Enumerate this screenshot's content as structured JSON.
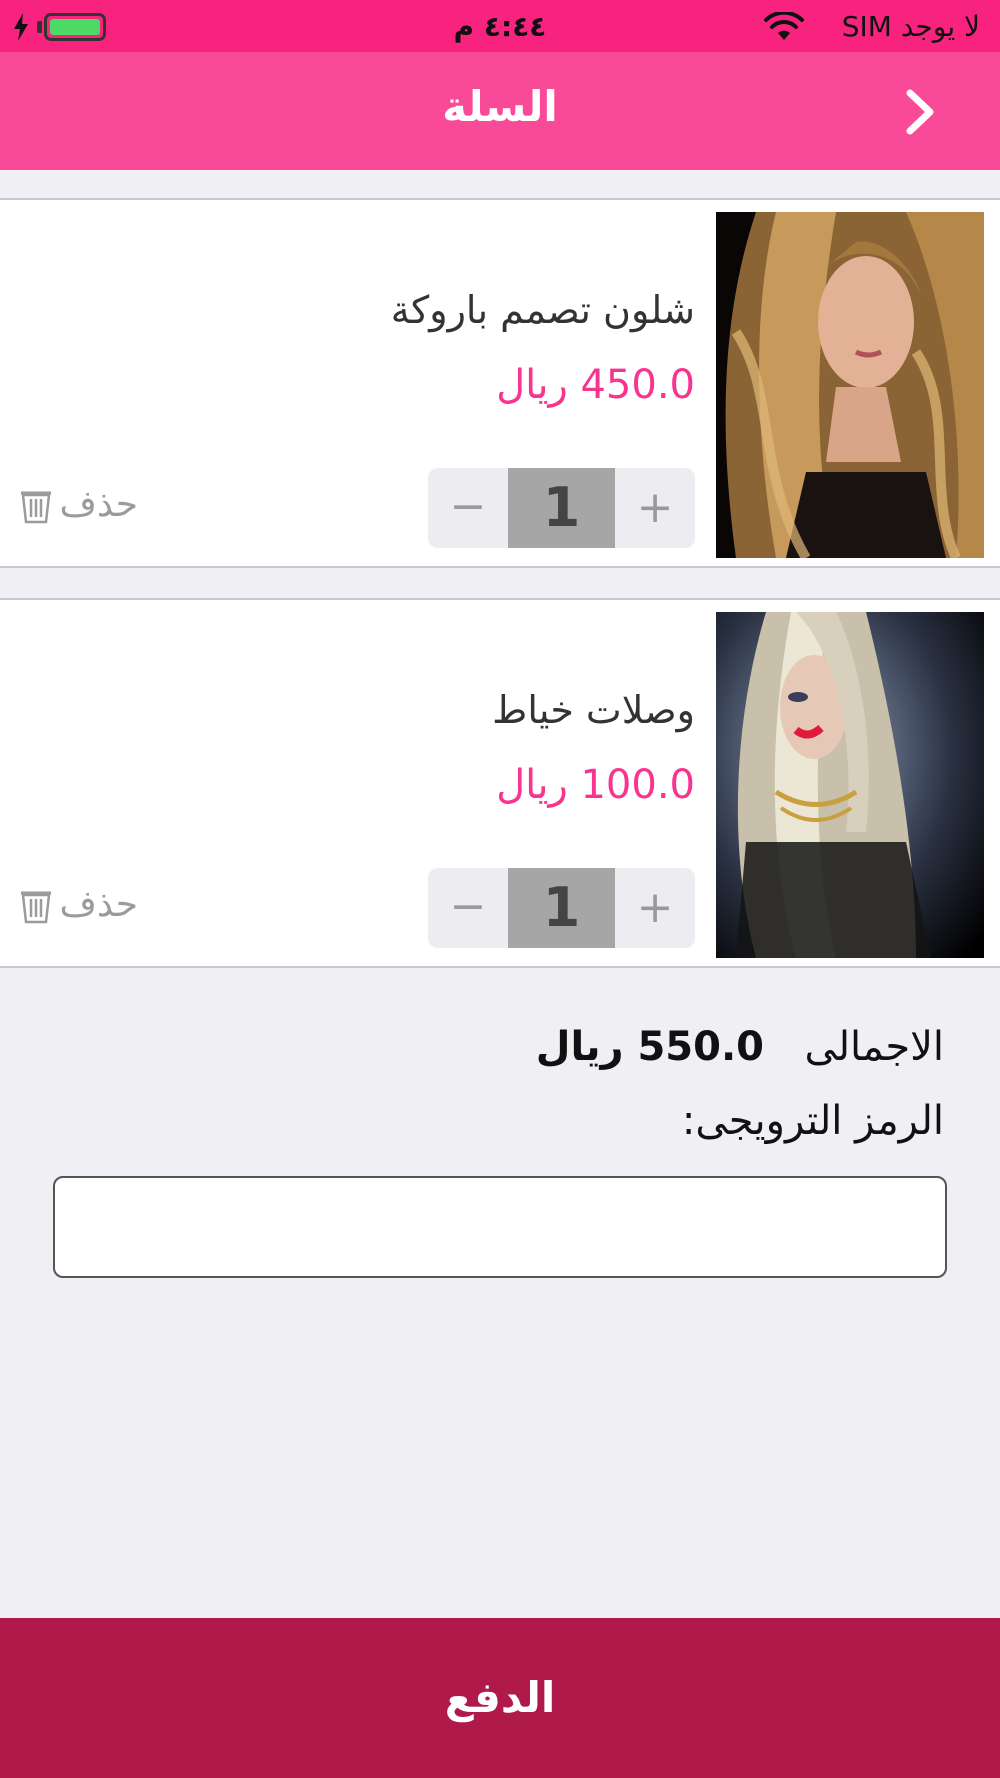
{
  "status_bar": {
    "carrier": "لا يوجد SIM",
    "time": "٤:٤٤ م"
  },
  "nav": {
    "title": "السلة"
  },
  "items": [
    {
      "name": "شلون تصمم باروكة",
      "price": "450.0 ريال",
      "quantity": "1",
      "delete_label": "حذف"
    },
    {
      "name": "وصلات خياط",
      "price": "100.0 ريال",
      "quantity": "1",
      "delete_label": "حذف"
    }
  ],
  "summary": {
    "total_label": "الاجمالى",
    "total_value": "550.0 ريال",
    "promo_label": "الرمز الترويجى:",
    "promo_value": ""
  },
  "pay_button": {
    "label": "الدفع"
  },
  "colors": {
    "status_bar": "#f7237f",
    "nav_bar": "#f94a98",
    "price": "#f7358f",
    "pay_button": "#b01a4a",
    "background": "#efeff4"
  },
  "stepper": {
    "plus": "+",
    "minus": "−"
  }
}
